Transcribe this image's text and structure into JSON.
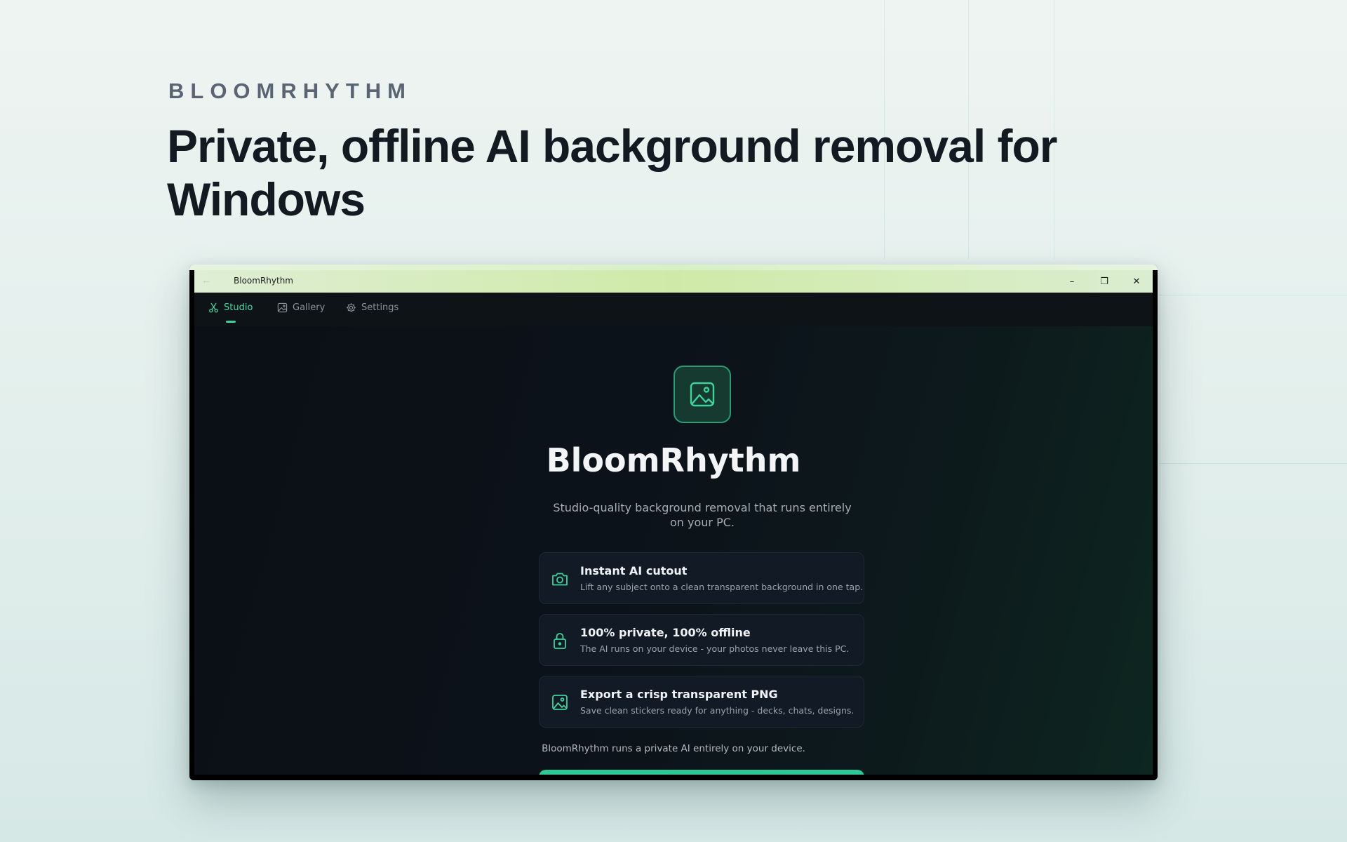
{
  "page": {
    "eyebrow": "BLOOMRHYTHM",
    "headline": "Private, offline AI background removal for Windows"
  },
  "window": {
    "title": "BloomRhythm",
    "controls": {
      "minimize": "–",
      "maximize": "❐",
      "close": "✕"
    }
  },
  "nav": {
    "tabs": [
      {
        "label": "Studio",
        "icon": "scissors-icon",
        "active": true
      },
      {
        "label": "Gallery",
        "icon": "image-icon",
        "active": false
      },
      {
        "label": "Settings",
        "icon": "gear-icon",
        "active": false
      }
    ]
  },
  "main": {
    "app_name": "BloomRhythm",
    "tagline": "Studio-quality background removal that runs entirely on your PC.",
    "features": [
      {
        "icon": "camera-icon",
        "title": "Instant AI cutout",
        "description": "Lift any subject onto a clean transparent background in one tap."
      },
      {
        "icon": "lock-icon",
        "title": "100% private, 100% offline",
        "description": "The AI runs on your device - your photos never leave this PC."
      },
      {
        "icon": "image-icon",
        "title": "Export a crisp transparent PNG",
        "description": "Save clean stickers ready for anything - decks, chats, designs."
      }
    ],
    "footnote": "BloomRhythm runs a private AI entirely on your device."
  },
  "colors": {
    "accent": "#3fd19a",
    "background_dark": "#0c1117",
    "card": "#121a26"
  }
}
